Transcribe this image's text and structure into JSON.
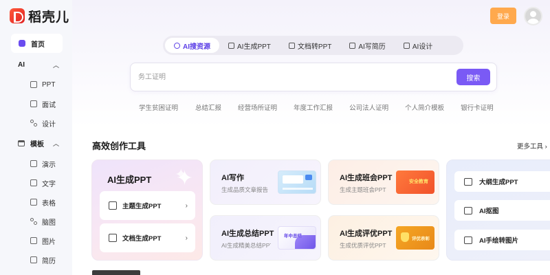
{
  "brand": {
    "name": "稻壳儿",
    "color": "#e8322a"
  },
  "sidebar": {
    "home": "首页",
    "sections": [
      {
        "label": "AI",
        "items": [
          "PPT",
          "面试",
          "设计"
        ]
      },
      {
        "label": "模板",
        "items": [
          "演示",
          "文字",
          "表格",
          "脑图",
          "图片",
          "简历"
        ]
      }
    ]
  },
  "header": {
    "login": "登录"
  },
  "tabs": [
    "AI搜资源",
    "AI生成PPT",
    "文档转PPT",
    "AI写简历",
    "AI设计"
  ],
  "search": {
    "placeholder": "务工证明",
    "button": "搜索"
  },
  "hot_words": [
    "学生贫困证明",
    "总结汇报",
    "经营场所证明",
    "年度工作汇报",
    "公司法人证明",
    "个人简介模板",
    "银行卡证明"
  ],
  "tools": {
    "title": "高效创作工具",
    "more": "更多工具",
    "featured": {
      "title": "AI生成PPT",
      "options": [
        "主题生成PPT",
        "文档生成PPT"
      ]
    },
    "cards": [
      {
        "title": "AI写作",
        "subtitle": "生成品质文章报告",
        "thumb": ""
      },
      {
        "title": "AI生成班会PPT",
        "subtitle": "生成主题班会PPT",
        "thumb": "安全教育"
      },
      {
        "title": "AI生成总结PPT",
        "subtitle": "AI生成精美总结PPT",
        "thumb": "年中总结"
      },
      {
        "title": "AI生成评优PPT",
        "subtitle": "生成优质评优PPT",
        "thumb": "评优表彰"
      }
    ],
    "side": [
      "大纲生成PPT",
      "AI抠图",
      "AI手绘转图片"
    ]
  },
  "colors": {
    "accent": "#7a5af5",
    "login": "#ffa94d"
  }
}
